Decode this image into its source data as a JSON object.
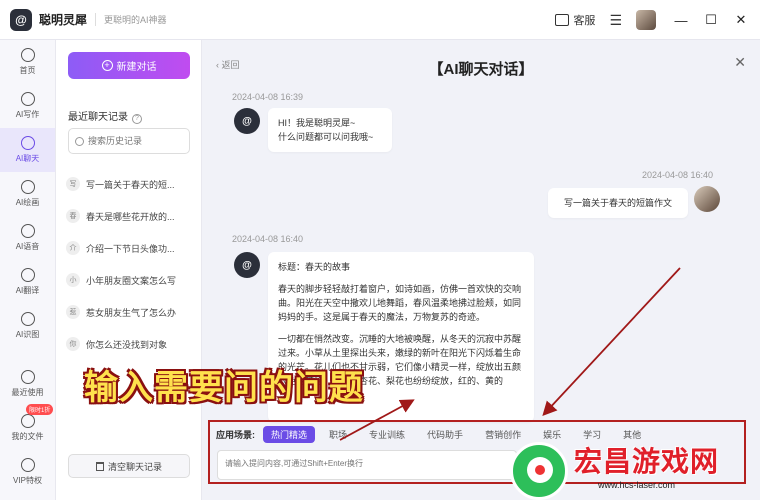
{
  "titlebar": {
    "logo_letter": "@",
    "app_name": "聪明灵犀",
    "slogan": "更聪明的AI神器",
    "service_label": "客服",
    "menu_glyph": "☰",
    "minimize": "—",
    "maximize": "☐",
    "close": "✕"
  },
  "nav": {
    "items": [
      {
        "label": "首页",
        "icon": "home-icon"
      },
      {
        "label": "AI写作",
        "icon": "pen-icon"
      },
      {
        "label": "AI聊天",
        "icon": "chat-icon",
        "active": true
      },
      {
        "label": "AI绘画",
        "icon": "brush-icon"
      },
      {
        "label": "AI语音",
        "icon": "headphone-icon"
      },
      {
        "label": "AI翻译",
        "icon": "translate-icon"
      },
      {
        "label": "AI识图",
        "icon": "scan-icon"
      }
    ],
    "bottom_items": [
      {
        "label": "最近使用",
        "icon": "clock-icon"
      },
      {
        "label": "我的文件",
        "icon": "file-icon"
      },
      {
        "label": "VIP特权",
        "icon": "diamond-icon"
      }
    ],
    "vip_badge": "限时1折"
  },
  "history": {
    "new_chat_label": "新建对话",
    "title": "最近聊天记录",
    "help_glyph": "?",
    "search_placeholder": "搜索历史记录",
    "items": [
      {
        "tag": "写",
        "text": "写一篇关于春天的短..."
      },
      {
        "tag": "春",
        "text": "春天是哪些花开放的..."
      },
      {
        "tag": "介",
        "text": "介绍一下节日头像功..."
      },
      {
        "tag": "小",
        "text": "小年朋友圈文案怎么写"
      },
      {
        "tag": "惹",
        "text": "惹女朋友生气了怎么办"
      },
      {
        "tag": "你",
        "text": "你怎么还没找到对象"
      }
    ],
    "clear_label": "清空聊天记录"
  },
  "chat": {
    "back_label": "返回",
    "title": "【AI聊天对话】",
    "close": "✕",
    "bot_avatar_letter": "@",
    "messages": [
      {
        "time": "2024-04-08 16:39",
        "role": "bot",
        "text_line1": "HI！我是聪明灵犀~",
        "text_line2": "什么问题都可以问我哦~"
      },
      {
        "time": "2024-04-08 16:40",
        "role": "user",
        "text": "写一篇关于春天的短篇作文"
      },
      {
        "time": "2024-04-08 16:40",
        "role": "bot",
        "heading": "标题：春天的故事",
        "para1": "春天的脚步轻轻敲打着窗户，如诗如画，仿佛一首欢快的交响曲。阳光在天空中撒欢儿地舞蹈，春风温柔地拂过脸颊，如同妈妈的手。这是属于春天的魔法，万物复苏的奇迹。",
        "para2": "一切都在悄然改变。沉睡的大地被唤醒，从冬天的沉寂中苏醒过来。小草从土里探出头来，嫩绿的新叶在阳光下闪烁着生命的光芒。花儿们也不甘示弱，它们像小精灵一样，绽放出五颜六色的笑脸。桃花、杏花、梨花也纷纷绽放，红的、黄的"
      }
    ]
  },
  "overlay": {
    "caption": "输入需要问的问题"
  },
  "composer": {
    "scene_label": "应用场景:",
    "scenes": [
      "热门精选",
      "职场",
      "专业训练",
      "代码助手",
      "营销创作",
      "娱乐",
      "学习",
      "其他"
    ],
    "input_placeholder": "请输入提问内容,可通过Shift+Enter换行"
  },
  "watermark": {
    "text": "宏昌游戏网",
    "url": "www.hcs-laser.com"
  },
  "colors": {
    "accent": "#6b4ce6",
    "highlight_border": "#b32020",
    "caption_fill": "#ffe14d"
  }
}
